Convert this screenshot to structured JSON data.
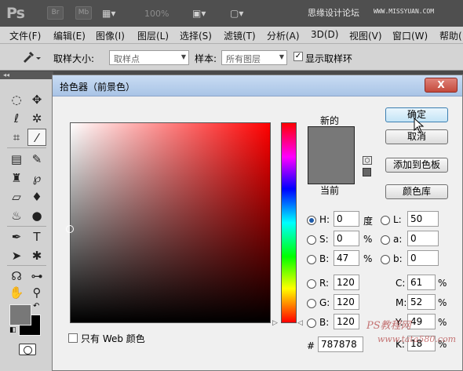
{
  "appbar": {
    "logo": "Ps",
    "badges": [
      "Br",
      "Mb"
    ],
    "zoom": "100%",
    "site_cn": "思缘设计论坛",
    "site_url": "WWW.MISSYUAN.COM"
  },
  "menu": [
    "文件(F)",
    "编辑(E)",
    "图像(I)",
    "图层(L)",
    "选择(S)",
    "滤镜(T)",
    "分析(A)",
    "3D(D)",
    "视图(V)",
    "窗口(W)",
    "帮助("
  ],
  "options": {
    "sample_size_label": "取样大小:",
    "sample_size_value": "取样点",
    "sample_label": "样本:",
    "sample_value": "所有图层",
    "show_ring_checked": "✓",
    "show_ring_label": "显示取样环"
  },
  "toolbar": {
    "collapse": "◂◂"
  },
  "dialog": {
    "title": "拾色器（前景色）",
    "close": "X",
    "new_label": "新的",
    "current_label": "当前",
    "ok": "确定",
    "cancel": "取消",
    "add_swatch": "添加到色板",
    "color_libraries": "颜色库",
    "web_only": "只有 Web 颜色",
    "fields": {
      "H": {
        "label": "H:",
        "value": "0",
        "unit": "度"
      },
      "S": {
        "label": "S:",
        "value": "0",
        "unit": "%"
      },
      "B": {
        "label": "B:",
        "value": "47",
        "unit": "%"
      },
      "R": {
        "label": "R:",
        "value": "120"
      },
      "G": {
        "label": "G:",
        "value": "120"
      },
      "Bl": {
        "label": "B:",
        "value": "120"
      },
      "L": {
        "label": "L:",
        "value": "50"
      },
      "a": {
        "label": "a:",
        "value": "0"
      },
      "b": {
        "label": "b:",
        "value": "0"
      },
      "C": {
        "label": "C:",
        "value": "61",
        "unit": "%"
      },
      "M": {
        "label": "M:",
        "value": "52",
        "unit": "%"
      },
      "Y": {
        "label": "Y:",
        "value": "49",
        "unit": "%"
      },
      "K": {
        "label": "K:",
        "value": "18",
        "unit": "%"
      },
      "hex_label": "#",
      "hex": "787878"
    }
  },
  "watermark": {
    "left_text": "PS教程网",
    "url": "www.tata580.com"
  },
  "colors": {
    "current": "#787878"
  }
}
